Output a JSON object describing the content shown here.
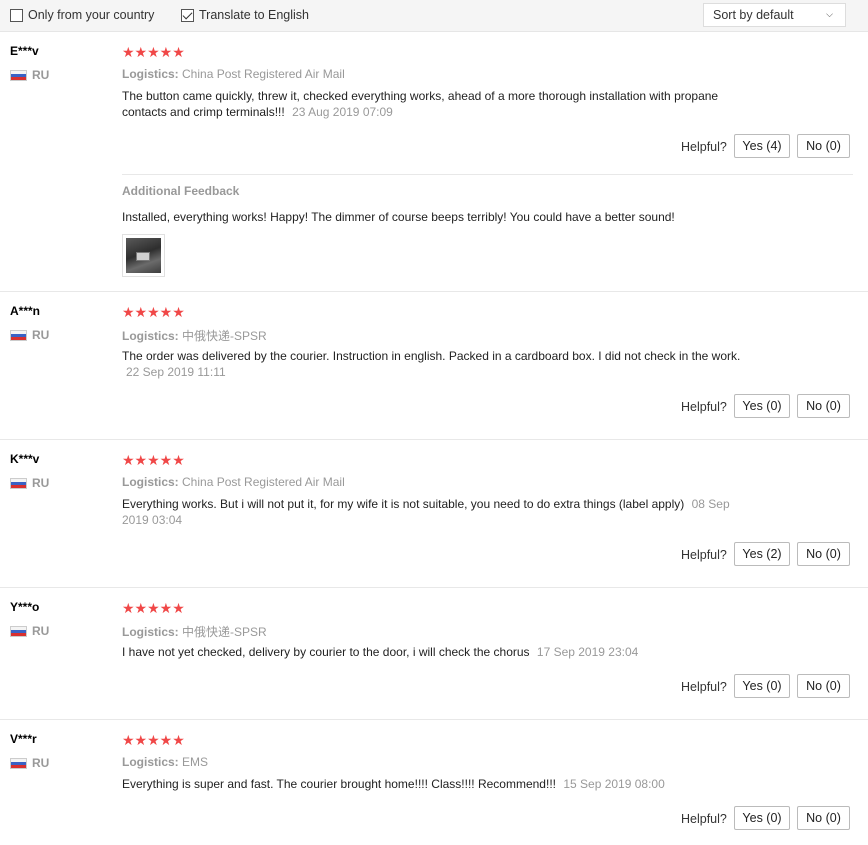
{
  "filters": {
    "country_label": "Only from your country",
    "country_checked": false,
    "translate_label": "Translate to English",
    "translate_checked": true,
    "sort_value": "Sort by default"
  },
  "helpful_label": "Helpful?",
  "logistics_label": "Logistics:",
  "additional_feedback_label": "Additional Feedback",
  "reviews": [
    {
      "user": "E***v",
      "country": "RU",
      "stars": "★★★★★",
      "logistics": "China Post Registered Air Mail",
      "text": "The button came quickly, threw it, checked everything works, ahead of a more thorough installation with propane contacts and crimp terminals!!!",
      "date": "23 Aug 2019 07:09",
      "yes": "Yes (4)",
      "no": "No (0)",
      "additional_text": "Installed, everything works! Happy! The dimmer of course beeps terribly! You could have a better sound!"
    },
    {
      "user": "A***n",
      "country": "RU",
      "stars": "★★★★★",
      "logistics": "中俄快递-SPSR",
      "text": "The order was delivered by the courier. Instruction in english. Packed in a cardboard box. I did not check in the work.",
      "date": "22 Sep 2019 11:11",
      "yes": "Yes (0)",
      "no": "No (0)"
    },
    {
      "user": "K***v",
      "country": "RU",
      "stars": "★★★★★",
      "logistics": "China Post Registered Air Mail",
      "text": "Everything works. But i will not put it, for my wife it is not suitable, you need to do extra things (label apply)",
      "date": "08 Sep 2019 03:04",
      "yes": "Yes (2)",
      "no": "No (0)"
    },
    {
      "user": "Y***o",
      "country": "RU",
      "stars": "★★★★★",
      "logistics": "中俄快递-SPSR",
      "text": "I have not yet checked, delivery by courier to the door, i will check the chorus",
      "date": "17 Sep 2019 23:04",
      "yes": "Yes (0)",
      "no": "No (0)"
    },
    {
      "user": "V***r",
      "country": "RU",
      "stars": "★★★★★",
      "logistics": "EMS",
      "text": "Everything is super and fast. The courier brought home!!!! Class!!!! Recommend!!!",
      "date": "15 Sep 2019 08:00",
      "yes": "Yes (0)",
      "no": "No (0)"
    }
  ]
}
